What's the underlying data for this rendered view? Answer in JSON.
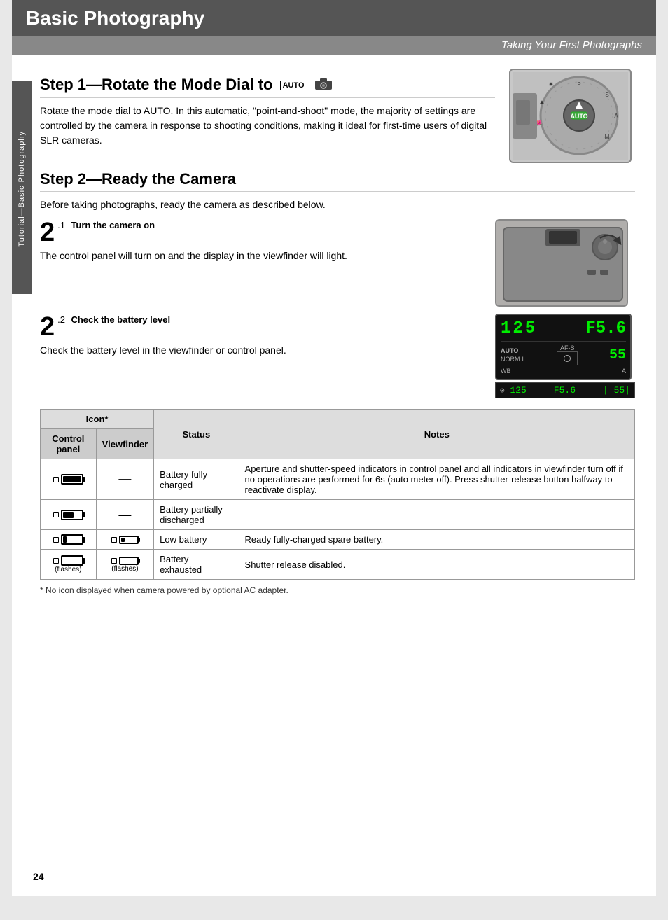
{
  "header": {
    "title": "Basic Photography",
    "subtitle": "Taking Your First Photographs"
  },
  "side_tab": {
    "label": "Tutorial—Basic Photography"
  },
  "step1": {
    "heading": "Step 1—Rotate the Mode Dial to",
    "auto_label": "AUTO",
    "body": "Rotate the mode dial to AUTO. In this automatic, \"point-and-shoot\" mode, the majority of settings are controlled by the camera in response to shooting conditions, making it ideal for first-time users of digital SLR cameras."
  },
  "step2": {
    "heading": "Step 2—Ready the Camera",
    "intro": "Before taking photographs, ready the camera as described below."
  },
  "substep1": {
    "number": "2",
    "num_label": ".1",
    "title": "Turn the camera on",
    "body": "The control panel will turn on and the display in the viewfinder will light."
  },
  "substep2": {
    "number": "2",
    "num_label": ".2",
    "title": "Check the battery level",
    "body": "Check the battery level in the viewfinder or control panel."
  },
  "viewfinder": {
    "shutter": "125",
    "aperture": "F5.6",
    "ss_strip": "125",
    "ap_strip": "F5.6",
    "val_strip": "55",
    "ss_main": "55",
    "auto_label": "AUTO",
    "afs_label": "AF-S",
    "norm_label": "NORM",
    "wb_label": "WB",
    "a_label": "A",
    "l_label": "L"
  },
  "table": {
    "header_icon": "Icon*",
    "col_control": "Control panel",
    "col_viewfinder": "Viewfinder",
    "col_status": "Status",
    "col_notes": "Notes",
    "rows": [
      {
        "status": "Battery fully charged",
        "notes": "Aperture and shutter-speed indicators in control panel and all indicators in viewfinder turn off if no operations are performed for 6s (auto meter off). Press shutter-release button halfway to reactivate display.",
        "control_icon": "full",
        "vf_icon": "dash"
      },
      {
        "status": "Battery partially discharged",
        "notes": "",
        "control_icon": "partial",
        "vf_icon": "dash"
      },
      {
        "status": "Low battery",
        "notes": "Ready fully-charged spare battery.",
        "control_icon": "low",
        "vf_icon": "low"
      },
      {
        "status": "Battery exhausted",
        "notes": "Shutter release disabled.",
        "control_icon": "empty_flash",
        "vf_icon": "empty_flash"
      }
    ],
    "footnote": "* No icon displayed when camera powered by optional AC adapter."
  },
  "page_number": "24"
}
